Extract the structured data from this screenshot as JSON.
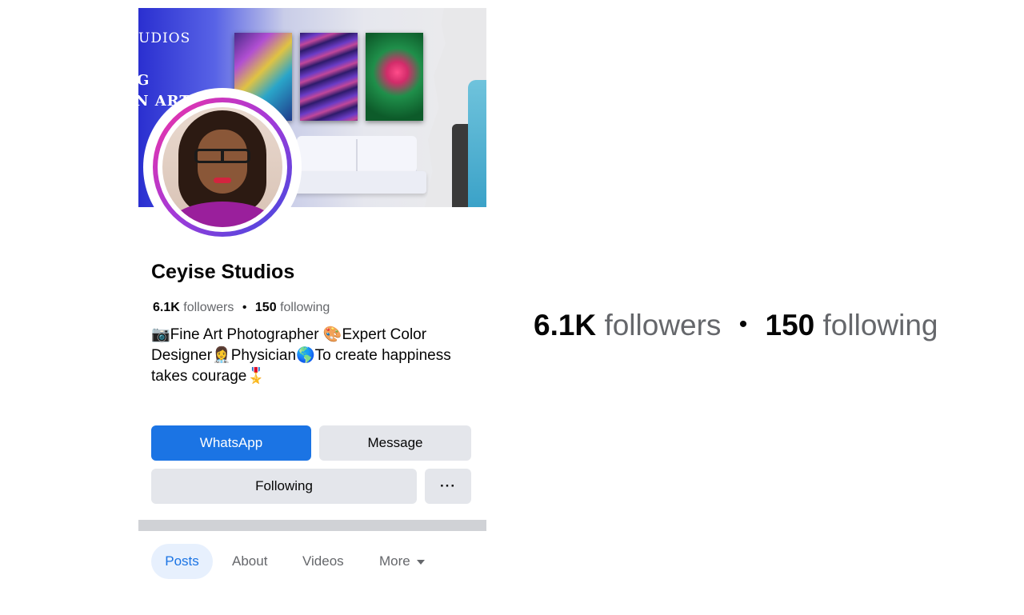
{
  "cover": {
    "text_line1": "UDIOS",
    "text_line2": "G",
    "text_line3": "N ART"
  },
  "profile": {
    "name": "Ceyise Studios",
    "followers_count": "6.1K",
    "followers_label": "followers",
    "following_count": "150",
    "following_label": "following",
    "separator": "•",
    "bio": "📷Fine Art Photographer 🎨Expert Color Designer👩‍⚕️Physician🌎To create happiness takes courage🎖️"
  },
  "actions": {
    "whatsapp_label": "WhatsApp",
    "message_label": "Message",
    "following_label": "Following",
    "more_label": "···"
  },
  "tabs": [
    {
      "label": "Posts",
      "active": true
    },
    {
      "label": "About",
      "active": false
    },
    {
      "label": "Videos",
      "active": false
    },
    {
      "label": "More",
      "active": false
    }
  ],
  "zoom": {
    "followers_count": "6.1K",
    "followers_label": "followers",
    "separator": "•",
    "following_count": "150",
    "following_label": "following"
  },
  "colors": {
    "primary_blue": "#1b74e4",
    "secondary_button": "#e4e6eb",
    "muted_text": "#65676b",
    "avatar_ring": "#a33ad8"
  }
}
